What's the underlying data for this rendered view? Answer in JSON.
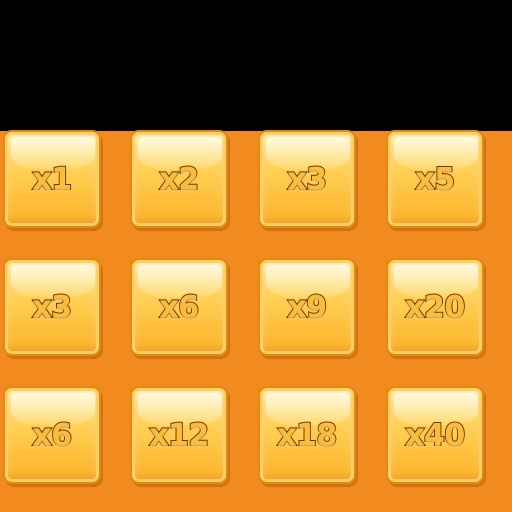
{
  "multiplier_grid": {
    "rows": [
      {
        "tiles": [
          {
            "label": "x1"
          },
          {
            "label": "x2"
          },
          {
            "label": "x3"
          },
          {
            "label": "x5"
          }
        ]
      },
      {
        "tiles": [
          {
            "label": "x3"
          },
          {
            "label": "x6"
          },
          {
            "label": "x9"
          },
          {
            "label": "x20"
          }
        ]
      },
      {
        "tiles": [
          {
            "label": "x6"
          },
          {
            "label": "x12"
          },
          {
            "label": "x18"
          },
          {
            "label": "x40"
          }
        ]
      }
    ]
  },
  "colors": {
    "background": "#000000",
    "backdrop": "#f18a1f",
    "tile_fill": "#fec13c",
    "tile_border": "#e08a0e",
    "label_outline": "#6b3b0a"
  }
}
